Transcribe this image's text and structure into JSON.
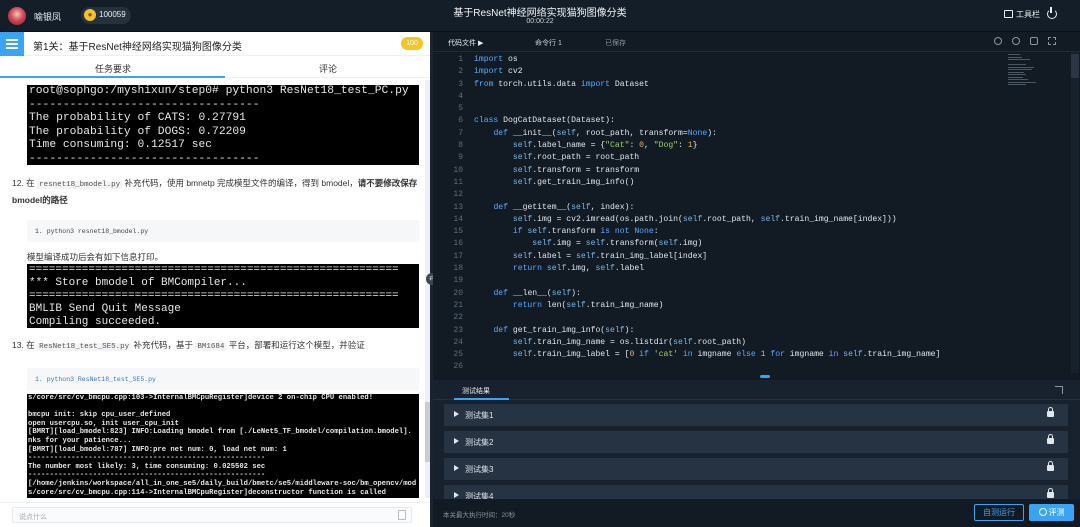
{
  "topbar": {
    "username": "喻银凤",
    "coins": "100059",
    "title": "基于ResNet神经网络实现猫狗图像分类",
    "timer": "00:00:22",
    "toolbox": "工具栏"
  },
  "left": {
    "level_title": "第1关：基于ResNet神经网络实现猫狗图像分类",
    "score": "100",
    "tabs": [
      "任务要求",
      "评论"
    ],
    "term1": "root@sophgo:/myshixun/step0# python3 ResNet18_test_PC.py\n----------------------------------\nThe probability of CATS: 0.27791\nThe probability of DOGS: 0.72209\nTime consuming: 0.12517 sec\n----------------------------------",
    "step12": {
      "num": "12. 在",
      "code": "resnet18_bmodel.py",
      "text": "补充代码，使用 bmnetp 完成模型文件的编译，得到 bmodel，",
      "bold": "请不要修改保存 bmodel的路径"
    },
    "cmd12": "1. python3 resnet18_bmodel.py",
    "plain1": "模型编译成功后会有如下信息打印。",
    "term2": "========================================================\n*** Store bmodel of BMCompiler...\n========================================================\nBMLIB Send Quit Message\nCompiling succeeded.",
    "step13": {
      "num": "13. 在",
      "code1": "ResNet18_test_SE5.py",
      "text1": "补充代码，基于",
      "code2": "BM1684",
      "text2": "平台，部署和运行这个模型，并验证"
    },
    "cmd13": "1. python3 ResNet18_test_SE5.py",
    "term3": "s/core/src/cv_bmcpu.cpp:103->InternalBMCpuRegister]device 2 on-chip CPU enabled!\n\nbmcpu init: skip cpu_user_defined\nopen usercpu.so, init user_cpu_init\n[BMRT][load_bmodel:823] INFO:Loading bmodel from [./LeNet5_TF_bmodel/compilation.bmodel].\nnks for your patience...\n[BMRT][load_bmodel:787] INFO:pre net num: 0, load net num: 1\n-------------------------------------------------------\nThe number most likely: 3, time consuming: 0.025502 sec\n-------------------------------------------------------\n[/home/jenkins/workspace/all_in_one_se5/daily_build/bmetc/se5/middleware-soc/bm_opencv/mod\ns/core/src/cv_bmcpu.cpp:114->InternalBMCpuRegister]deconstructor function is called",
    "chat_placeholder": "说点什么"
  },
  "editor": {
    "tabs": [
      "代码文件 ▶",
      "命令行 1",
      "已保存"
    ],
    "line_numbers": "1\n2\n3\n4\n5\n6\n7\n8\n9\n10\n11\n12\n13\n14\n15\n16\n17\n18\n19\n20\n21\n22\n23\n24\n25\n26",
    "code_lines": [
      "import os",
      "import cv2",
      "from torch.utils.data import Dataset",
      "",
      "",
      "class DogCatDataset(Dataset):",
      "    def __init__(self, root_path, transform=None):",
      "        self.label_name = {\"Cat\": 0, \"Dog\": 1}",
      "        self.root_path = root_path",
      "        self.transform = transform",
      "        self.get_train_img_info()",
      "",
      "    def __getitem__(self, index):",
      "        self.img = cv2.imread(os.path.join(self.root_path, self.train_img_name[index]))",
      "        if self.transform is not None:",
      "            self.img = self.transform(self.img)",
      "        self.label = self.train_img_label[index]",
      "        return self.img, self.label",
      "",
      "    def __len__(self):",
      "        return len(self.train_img_name)",
      "",
      "    def get_train_img_info(self):",
      "        self.train_img_name = os.listdir(self.root_path)",
      "        self.train_img_label = [0 if 'cat' in imgname else 1 for imgname in self.train_img_name]",
      ""
    ]
  },
  "results": {
    "title": "测试结果",
    "cases": [
      "测试集1",
      "测试集2",
      "测试集3",
      "测试集4"
    ],
    "exec_time": "本关最大执行时间：20秒",
    "run_label": "自测运行",
    "eval_label": "评测"
  },
  "colors": {
    "accent": "#3aa3f2",
    "score_badge": "#f7c325",
    "editor_bg": "#121b24"
  }
}
